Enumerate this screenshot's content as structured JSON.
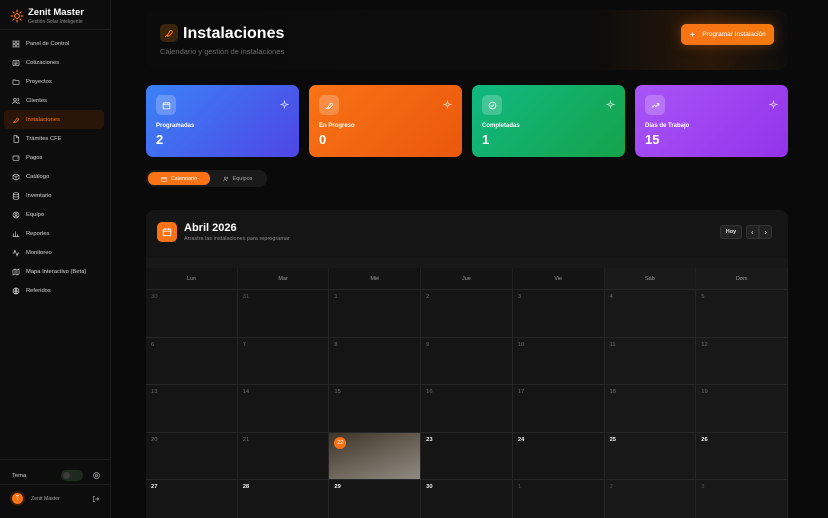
{
  "sidebar": {
    "brand_title": "Zenit Master",
    "brand_subtitle": "Gestión Solar Inteligente",
    "items": [
      {
        "label": "Panel de Control",
        "icon": "dashboard-icon"
      },
      {
        "label": "Cotizaciones",
        "icon": "document-icon"
      },
      {
        "label": "Proyectos",
        "icon": "folder-icon"
      },
      {
        "label": "Clientes",
        "icon": "users-icon"
      },
      {
        "label": "Instalaciones",
        "icon": "wrench-icon",
        "active": true
      },
      {
        "label": "Trámites CFE",
        "icon": "file-icon"
      },
      {
        "label": "Pagos",
        "icon": "wallet-icon"
      },
      {
        "label": "Catálogo",
        "icon": "box-icon"
      },
      {
        "label": "Inventario",
        "icon": "database-icon"
      },
      {
        "label": "Equipo",
        "icon": "team-icon"
      },
      {
        "label": "Reportes",
        "icon": "report-icon"
      },
      {
        "label": "Monitoreo",
        "icon": "activity-icon"
      },
      {
        "label": "Mapa Interactivo (Beta)",
        "icon": "map-icon"
      },
      {
        "label": "Referidos",
        "icon": "globe-icon"
      }
    ],
    "theme_label": "Tema",
    "user_initial": "T",
    "user_name": "Zenit Master"
  },
  "header": {
    "title": "Instalaciones",
    "subtitle": "Calendario y gestión de instalaciones",
    "program_button": "Programar Instalación"
  },
  "stats": [
    {
      "label": "Programadas",
      "value": "2",
      "color": "#3b82f6"
    },
    {
      "label": "En Progreso",
      "value": "0",
      "color": "#f97316"
    },
    {
      "label": "Completadas",
      "value": "1",
      "color": "#10b981"
    },
    {
      "label": "Días de Trabajo",
      "value": "15",
      "color": "#a855f7"
    }
  ],
  "tabs": {
    "calendar": "Calendario",
    "teams": "Equipos"
  },
  "calendar": {
    "title": "Abril 2026",
    "subtitle": "Arrastra las instalaciones para reprogramar",
    "today_button": "Hoy",
    "weekdays": [
      "Lun",
      "Mar",
      "Mié",
      "Jue",
      "Vie",
      "Sáb",
      "Dom"
    ],
    "weeks": [
      [
        "30",
        "31",
        "1",
        "2",
        "3",
        "4",
        "5"
      ],
      [
        "6",
        "7",
        "8",
        "9",
        "10",
        "11",
        "12"
      ],
      [
        "13",
        "14",
        "15",
        "16",
        "17",
        "18",
        "19"
      ],
      [
        "20",
        "21",
        "22",
        "23",
        "24",
        "25",
        "26"
      ],
      [
        "27",
        "28",
        "29",
        "30",
        "1",
        "2",
        "3"
      ]
    ],
    "today": "22"
  },
  "colors": {
    "accent": "#f97316",
    "background": "#0a0a0a"
  }
}
